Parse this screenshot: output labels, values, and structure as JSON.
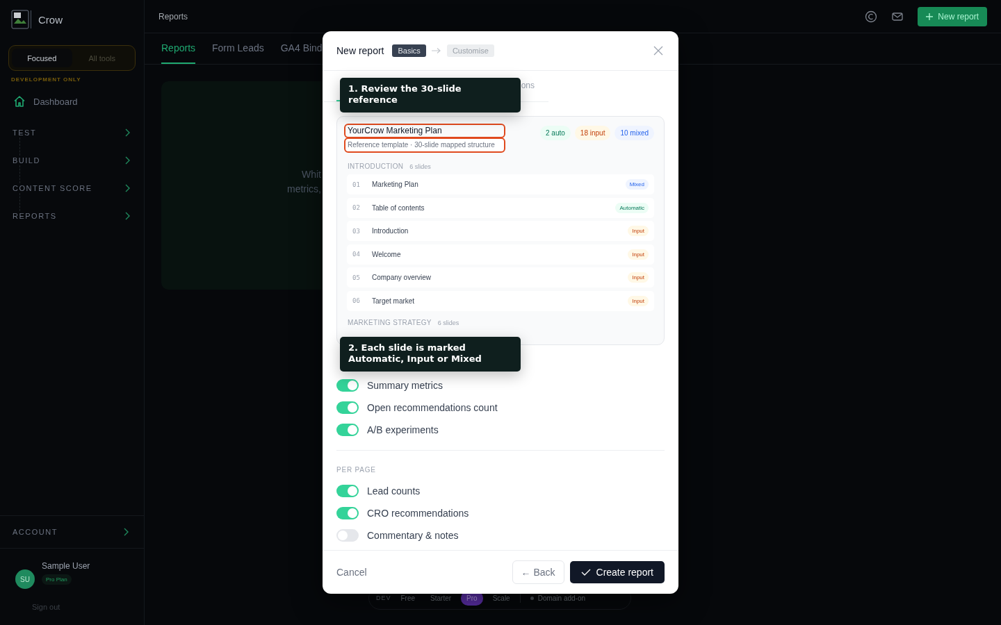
{
  "sidebar": {
    "brand": "Crow",
    "mode_switch": [
      {
        "label": "Focused",
        "selected": true
      },
      {
        "label": "All tools",
        "selected": false
      }
    ],
    "dev_note": "DEVELOPMENT ONLY",
    "items": [
      {
        "label": "Dashboard"
      }
    ],
    "groups": [
      {
        "label": "TEST"
      },
      {
        "label": "BUILD"
      },
      {
        "label": "CONTENT SCORE"
      },
      {
        "label": "REPORTS"
      }
    ],
    "account": "ACCOUNT",
    "user": {
      "initials": "SU",
      "name": "Sample User",
      "plan": "Pro Plan",
      "sign_out": "Sign out"
    }
  },
  "header": {
    "title": "Reports",
    "button": "New report"
  },
  "tabs": [
    {
      "label": "Reports",
      "selected": true
    },
    {
      "label": "Form Leads",
      "selected": false
    },
    {
      "label": "GA4 Bind",
      "selected": false
    }
  ],
  "card": {
    "lines": [
      "Whit",
      "metrics,"
    ]
  },
  "plan_bar": {
    "label": "DEV",
    "plans": [
      {
        "label": "Free",
        "selected": false
      },
      {
        "label": "Starter",
        "selected": false
      },
      {
        "label": "Pro",
        "selected": true
      },
      {
        "label": "Scale",
        "selected": false
      }
    ],
    "addon": "Domain add-on"
  },
  "modal": {
    "title": "New report",
    "steps": [
      {
        "label": "Basics",
        "selected": true
      },
      {
        "label": "Customise",
        "selected": false
      }
    ],
    "tabs": [
      {
        "selected": true
      },
      {
        "label": "ons",
        "selected": false
      }
    ],
    "template": {
      "title": "YourCrow Marketing Plan",
      "subtitle": "Reference template · 30-slide mapped structure",
      "counts": [
        {
          "label": "2 auto",
          "kind": "automatic"
        },
        {
          "label": "18 input",
          "kind": "input"
        },
        {
          "label": "10 mixed",
          "kind": "mixed"
        }
      ],
      "sections": [
        {
          "title": "INTRODUCTION",
          "count": "6 slides",
          "slides": [
            {
              "number": "01",
              "name": "Marketing Plan",
              "kind": "mixed",
              "tag": "Mixed"
            },
            {
              "number": "02",
              "name": "Table of contents",
              "kind": "automatic",
              "tag": "Automatic"
            },
            {
              "number": "03",
              "name": "Introduction",
              "kind": "input",
              "tag": "Input"
            },
            {
              "number": "04",
              "name": "Welcome",
              "kind": "input",
              "tag": "Input"
            },
            {
              "number": "05",
              "name": "Company overview",
              "kind": "input",
              "tag": "Input"
            },
            {
              "number": "06",
              "name": "Target market",
              "kind": "input",
              "tag": "Input"
            }
          ]
        },
        {
          "title": "MARKETING STRATEGY",
          "count": "6 slides"
        }
      ]
    },
    "option_groups": [
      {
        "options": [
          {
            "label": "Summary metrics",
            "on": true
          },
          {
            "label": "Open recommendations count",
            "on": true
          },
          {
            "label": "A/B experiments",
            "on": true
          }
        ]
      },
      {
        "title": "PER PAGE",
        "options": [
          {
            "label": "Lead counts",
            "on": true
          },
          {
            "label": "CRO recommendations",
            "on": true
          },
          {
            "label": "Commentary & notes",
            "on": false
          }
        ]
      }
    ],
    "footer": {
      "cancel": "Cancel",
      "back": "← Back",
      "create": "Create report"
    },
    "tooltips": [
      {
        "text": "1. Review the 30-slide reference"
      },
      {
        "text": "2. Each slide is marked Automatic, Input or Mixed"
      }
    ]
  }
}
